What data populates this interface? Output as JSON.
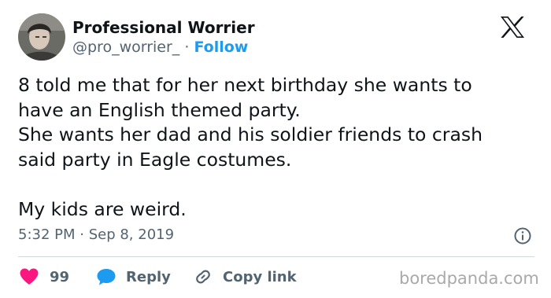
{
  "author": {
    "name": "Professional Worrier",
    "handle": "@pro_worrier_",
    "separator": "·",
    "follow_label": "Follow"
  },
  "tweet": {
    "text": "8 told me that for her next birthday she wants to\nhave an English themed party.\nShe wants her dad and his soldier friends to crash\nsaid party in Eagle costumes.\n\nMy kids are weird.",
    "timestamp": "5:32 PM · Sep 8, 2019"
  },
  "actions": {
    "likes_count": "99",
    "reply_label": "Reply",
    "copy_link_label": "Copy link"
  },
  "colors": {
    "like": "#f91880",
    "reply": "#1d9bf0",
    "follow": "#1d9bf0",
    "secondary_text": "#536471"
  },
  "icons": {
    "logo": "x-logo-icon",
    "info": "info-icon",
    "like": "heart-icon",
    "reply": "speech-bubble-icon",
    "copy_link": "link-icon"
  },
  "watermark": "boredpanda.com"
}
